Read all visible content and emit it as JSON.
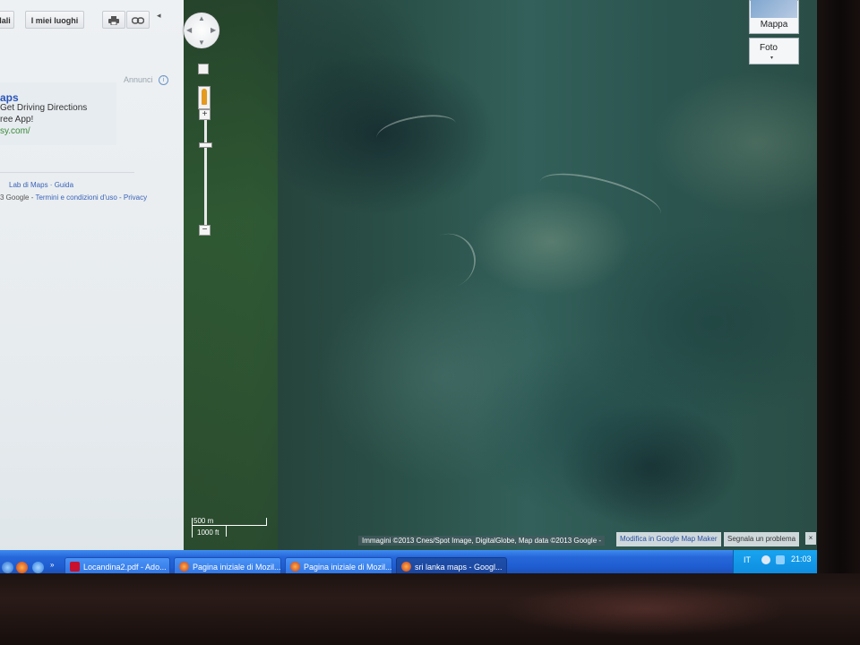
{
  "left_panel": {
    "toolbar": {
      "details_label": "dali",
      "places_label": "I miei luoghi",
      "print_icon": "printer-icon",
      "link_icon": "link-icon",
      "collapse_icon": "◂"
    },
    "ads_label": "Annunci",
    "ad": {
      "title": "aps",
      "line1": "Get Driving Directions",
      "line2": "ree App!",
      "url": "sy.com/"
    },
    "footer": {
      "links_row": "Lab di Maps · Guida",
      "copyright": "3 Google - ",
      "terms": "Termini e condizioni d'uso",
      "sep": " - ",
      "privacy": "Privacy"
    }
  },
  "map": {
    "zoom_in_symbol": "+",
    "zoom_out_symbol": "−",
    "map_type_label": "Mappa",
    "photo_label": "Foto",
    "photo_caret": "▾",
    "scale_top": "500 m",
    "scale_bottom": "1000 ft",
    "attribution": "Immagini ©2013 Cnes/Spot Image, DigitalGlobe, Map data ©2013 Google -",
    "report_mapmaker": "Modifica in Google Map Maker",
    "report_problem": "Segnala un problema",
    "close_symbol": "×"
  },
  "taskbar": {
    "quicklaunch_more": "»",
    "tasks": [
      {
        "label": "Locandina2.pdf - Ado...",
        "icon_color": "#c8102e"
      },
      {
        "label": "Pagina iniziale di Mozil...",
        "icon_color": "#e8641b"
      },
      {
        "label": "Pagina iniziale di Mozil...",
        "icon_color": "#e8641b"
      },
      {
        "label": "sri lanka maps - Googl...",
        "icon_color": "#e8641b"
      }
    ],
    "tray": {
      "lang": "IT",
      "time": "21:03"
    }
  }
}
